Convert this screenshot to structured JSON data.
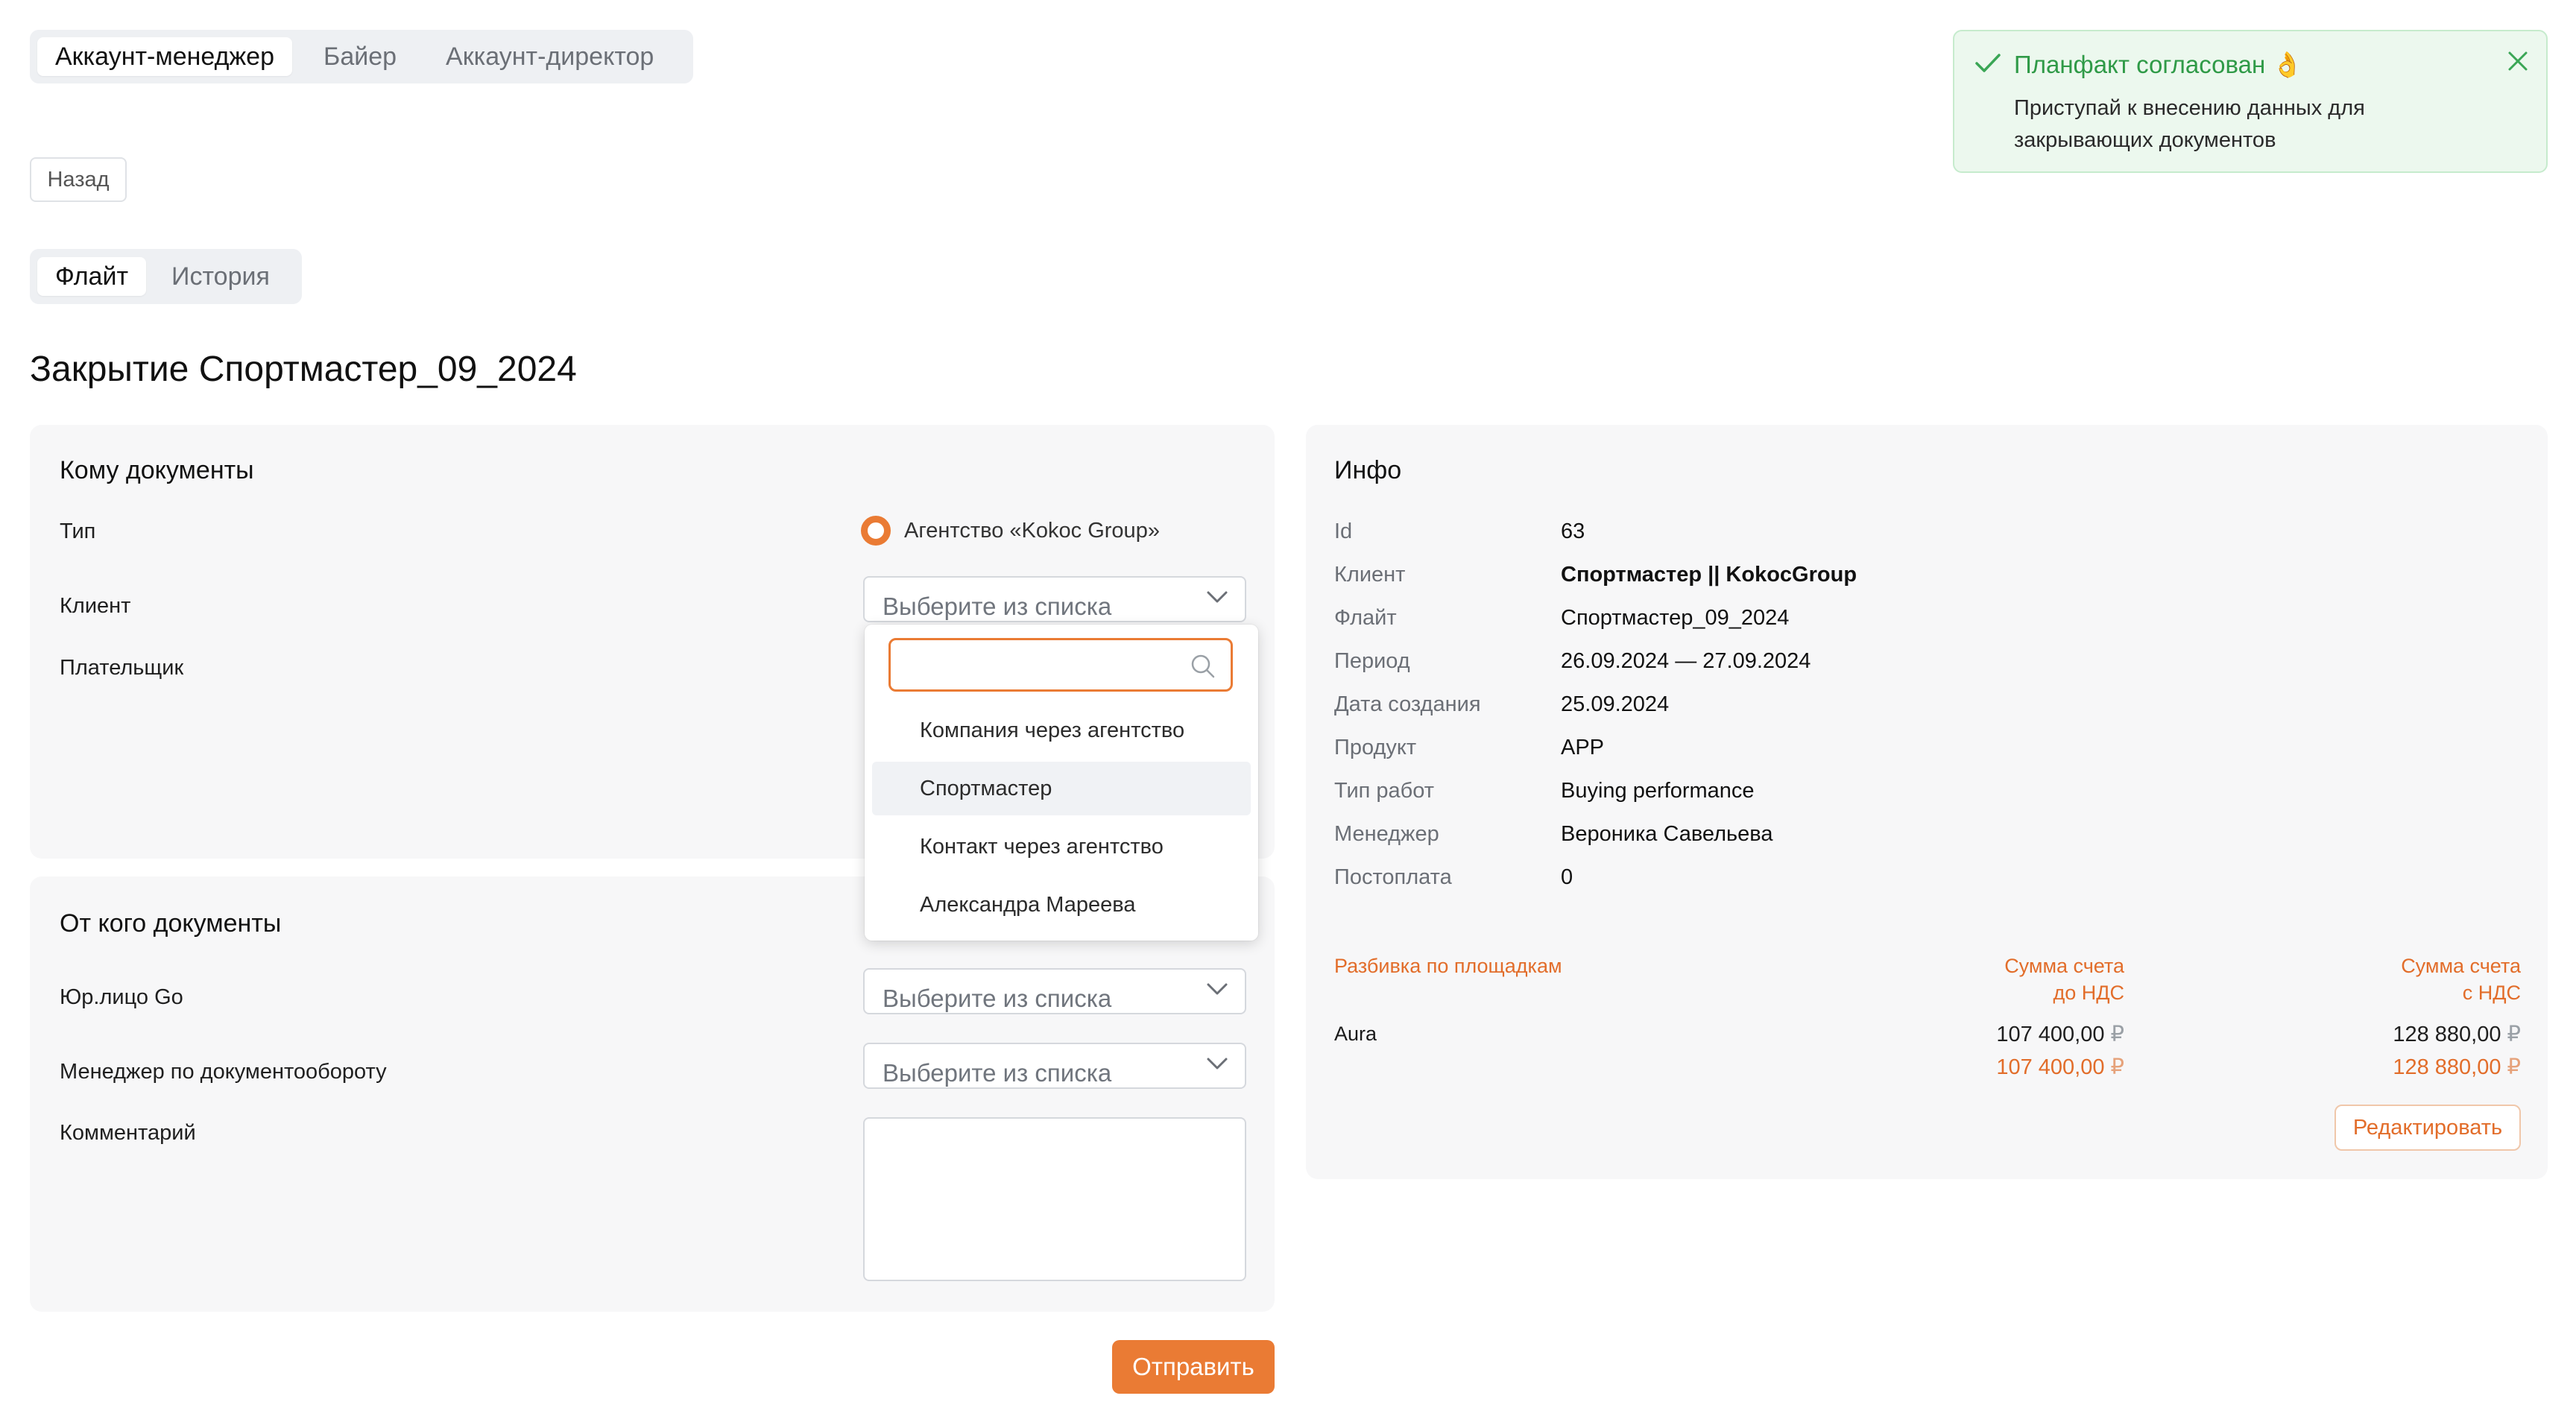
{
  "role_tabs": [
    "Аккаунт-менеджер",
    "Байер",
    "Аккаунт-директор"
  ],
  "back_label": "Назад",
  "view_tabs": [
    "Флайт",
    "История"
  ],
  "page_title": "Закрытие Спортмастер_09_2024",
  "to_card": {
    "title": "Кому документы",
    "type_label": "Тип",
    "type_option": "Агентство «Kokoc Group»",
    "client_label": "Клиент",
    "client_placeholder": "Выберите из списка",
    "payer_label": "Плательщик"
  },
  "dropdown": {
    "search_value": "",
    "items": [
      "Компания через агентство",
      "Спортмастер",
      "Контакт через агентство",
      "Александра Мареева"
    ]
  },
  "from_card": {
    "title": "От кого документы",
    "legal_label": "Юр.лицо Go",
    "legal_placeholder": "Выберите из списка",
    "manager_label": "Менеджер по документообороту",
    "manager_placeholder": "Выберите из списка",
    "comment_label": "Комментарий"
  },
  "submit_label": "Отправить",
  "info": {
    "title": "Инфо",
    "rows": [
      {
        "k": "Id",
        "v": "63"
      },
      {
        "k": "Клиент",
        "v": "Спортмастер || KokocGroup"
      },
      {
        "k": "Флайт",
        "v": "Спортмастер_09_2024"
      },
      {
        "k": "Период",
        "v": "26.09.2024 — 27.09.2024"
      },
      {
        "k": "Дата создания",
        "v": "25.09.2024"
      },
      {
        "k": "Продукт",
        "v": "APP"
      },
      {
        "k": "Тип работ",
        "v": "Buying performance"
      },
      {
        "k": "Менеджер",
        "v": "Вероника Савельева"
      },
      {
        "k": "Постоплата",
        "v": "0"
      }
    ],
    "table": {
      "col1": "Разбивка по площадкам",
      "col2_l1": "Сумма счета",
      "col2_l2": "до НДС",
      "col3_l1": "Сумма счета",
      "col3_l2": "с НДС",
      "row_name": "Aura",
      "row_pre": "107 400,00",
      "row_post": "128 880,00",
      "total_pre": "107 400,00",
      "total_post": "128 880,00",
      "currency": "₽"
    },
    "edit_label": "Редактировать"
  },
  "toast": {
    "title": "Планфакт согласован 👌",
    "body": "Приступай к внесению данных для закрывающих документов"
  },
  "colors": {
    "accent": "#ea7b34",
    "success": "#2f9a47"
  }
}
